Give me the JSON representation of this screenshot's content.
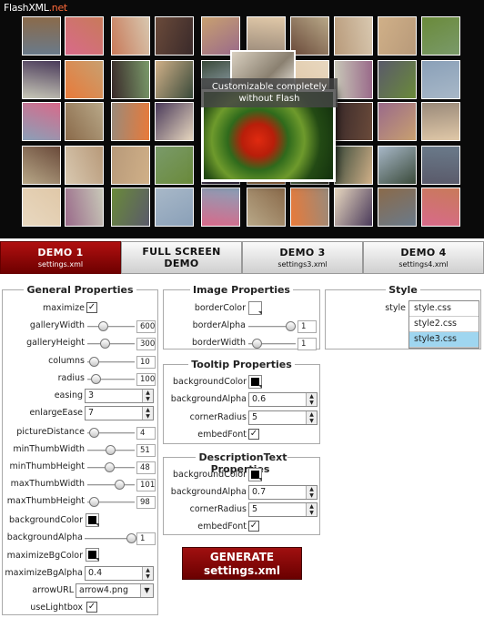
{
  "banner": {
    "logo_text": "FlashXML",
    "logo_suffix": ".net",
    "caption_line1": "Customizable completely",
    "caption_line2": "without Flash"
  },
  "tabs": [
    {
      "title": "DEMO 1",
      "subtitle": "settings.xml",
      "active": true
    },
    {
      "title": "FULL SCREEN",
      "subtitle": "DEMO",
      "active": false
    },
    {
      "title": "DEMO 3",
      "subtitle": "settings3.xml",
      "active": false
    },
    {
      "title": "DEMO 4",
      "subtitle": "settings4.xml",
      "active": false
    }
  ],
  "general": {
    "title": "General Properties",
    "maximize_label": "maximize",
    "galleryWidth_label": "galleryWidth",
    "galleryWidth_value": "600",
    "galleryHeight_label": "galleryHeight",
    "galleryHeight_value": "300",
    "columns_label": "columns",
    "columns_value": "10",
    "radius_label": "radius",
    "radius_value": "100",
    "easing_label": "easing",
    "easing_value": "3",
    "enlargeEase_label": "enlargeEase",
    "enlargeEase_value": "7",
    "pictureDistance_label": "pictureDistance",
    "pictureDistance_value": "4",
    "minThumbWidth_label": "minThumbWidth",
    "minThumbWidth_value": "51",
    "minThumbHeight_label": "minThumbHeight",
    "minThumbHeight_value": "48",
    "maxThumbWidth_label": "maxThumbWidth",
    "maxThumbWidth_value": "101",
    "maxThumbHeight_label": "maxThumbHeight",
    "maxThumbHeight_value": "98",
    "backgroundColor_label": "backgroundColor",
    "backgroundAlpha_label": "backgroundAlpha",
    "backgroundAlpha_value": "1",
    "maximizeBgColor_label": "maximizeBgColor",
    "maximizeBgAlpha_label": "maximizeBgAlpha",
    "maximizeBgAlpha_value": "0.4",
    "arrowURL_label": "arrowURL",
    "arrowURL_value": "arrow4.png",
    "useLightbox_label": "useLightbox"
  },
  "image": {
    "title": "Image Properties",
    "borderColor_label": "borderColor",
    "borderAlpha_label": "borderAlpha",
    "borderAlpha_value": "1",
    "borderWidth_label": "borderWidth",
    "borderWidth_value": "1"
  },
  "tooltip": {
    "title": "Tooltip Properties",
    "backgroundColor_label": "backgroundColor",
    "backgroundAlpha_label": "backgroundAlpha",
    "backgroundAlpha_value": "0.6",
    "cornerRadius_label": "cornerRadius",
    "cornerRadius_value": "5",
    "embedFont_label": "embedFont"
  },
  "description": {
    "title": "DescriptionText Properties",
    "backgroundColor_label": "backgroundColor",
    "backgroundAlpha_label": "backgroundAlpha",
    "backgroundAlpha_value": "0.7",
    "cornerRadius_label": "cornerRadius",
    "cornerRadius_value": "5",
    "embedFont_label": "embedFont"
  },
  "style": {
    "title": "Style",
    "label": "style",
    "options": [
      "style.css",
      "style2.css",
      "style3.css"
    ],
    "selected": "style3.css"
  },
  "generate": {
    "line1": "GENERATE",
    "line2": "settings.xml"
  },
  "colors": {
    "accent": "#8b0000",
    "selection": "#9fd6f0",
    "banner_bg": "#0a0a0a"
  }
}
